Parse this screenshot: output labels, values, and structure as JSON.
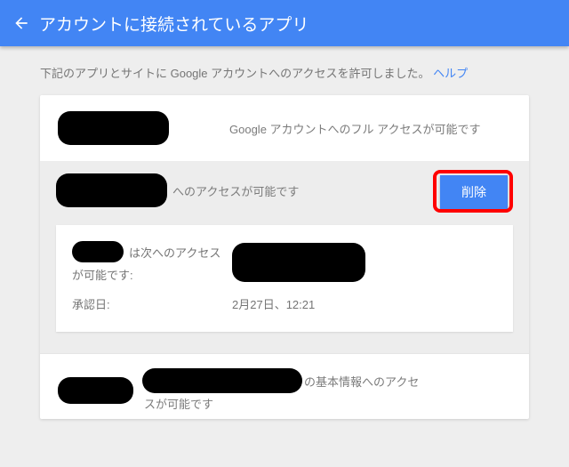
{
  "header": {
    "title": "アカウントに接続されているアプリ"
  },
  "intro": {
    "text": "下記のアプリとサイトに Google アカウントへのアクセスを許可しました。",
    "help": "ヘルプ"
  },
  "row1": {
    "desc": "Google アカウントへのフル アクセスが可能です"
  },
  "expanded": {
    "desc_suffix": "へのアクセスが可能です",
    "remove_label": "削除",
    "access_label_mid": "は次へのアクセス",
    "access_label_suffix": "が可能です:",
    "auth_date_label": "承認日:",
    "auth_date_value": "2月27日、12:21"
  },
  "row3": {
    "suffix1": "の基本情報へのアクセ",
    "suffix2": "スが可能です"
  }
}
